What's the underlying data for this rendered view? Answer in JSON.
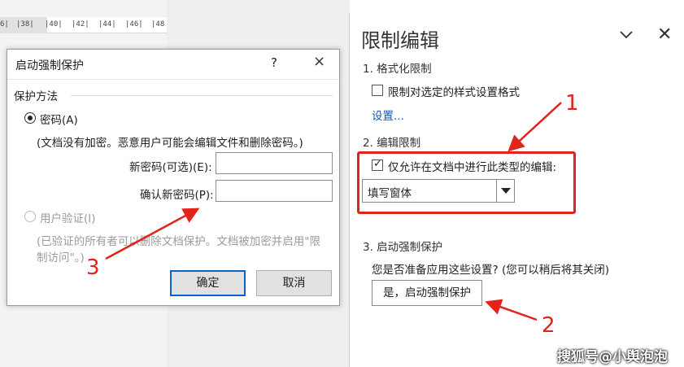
{
  "ruler": {
    "ticks": [
      "6|",
      "|38|",
      "|40|",
      "|42|",
      "|44|",
      "|46|",
      "|48"
    ]
  },
  "dialog": {
    "title": "启动强制保护",
    "help_label": "?",
    "close_label": "×",
    "group_label": "保护方法",
    "password_option": "密码(A)",
    "password_note": "(文档没有加密。恶意用户可能会编辑文件和删除密码。)",
    "new_password_label": "新密码(可选)(E):",
    "new_password_value": "",
    "confirm_password_label": "确认新密码(P):",
    "confirm_password_value": "",
    "user_auth_option": "用户验证(I)",
    "user_auth_note_line1": "(已验证的所有者可以删除文档保护。文档被加密并启用\"限",
    "user_auth_note_line2": "制访问\"。)",
    "ok_label": "确定",
    "cancel_label": "取消"
  },
  "pane": {
    "title": "限制编辑",
    "section1": "1. 格式化限制",
    "format_checkbox_label": "限制对选定的样式设置格式",
    "settings_link": "设置...",
    "section2": "2. 编辑限制",
    "edit_checkbox_label": "仅允许在文档中进行此类型的编辑:",
    "edit_type_value": "填写窗体",
    "section3": "3. 启动强制保护",
    "start_question": "您是否准备应用这些设置? (您可以稍后将其关闭)",
    "start_button_label": "是，启动强制保护"
  },
  "annotations": {
    "one": "1",
    "two": "2",
    "three": "3"
  },
  "watermark": "搜狐号@小舆泡泡",
  "colors": {
    "annotation_red": "#e2231a",
    "link_blue": "#1a56b0",
    "default_button_border": "#0a64c8"
  }
}
